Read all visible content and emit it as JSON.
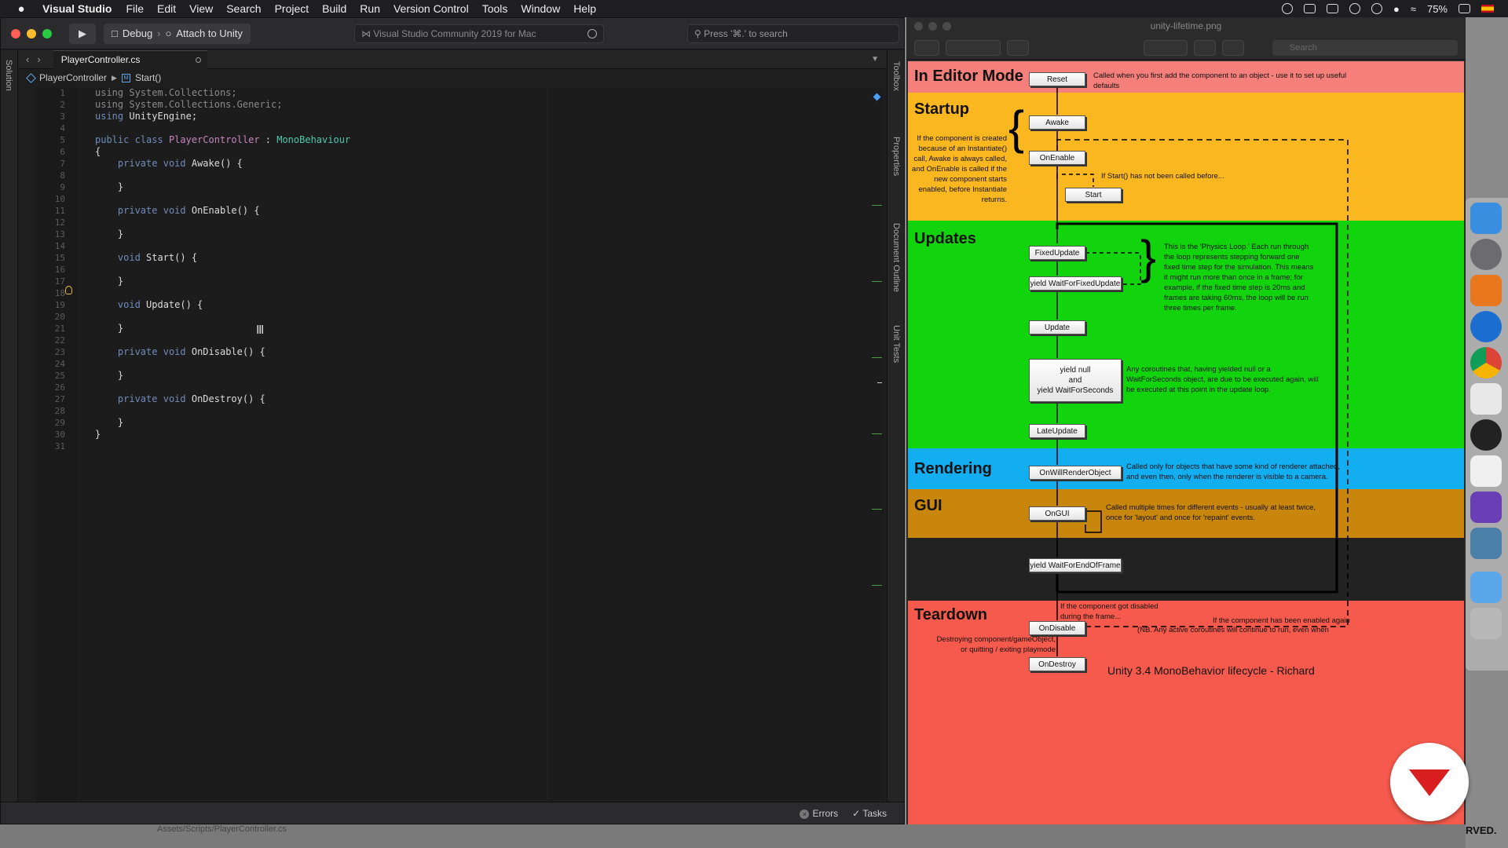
{
  "menubar": {
    "app_name": "Visual Studio",
    "items": [
      "File",
      "Edit",
      "View",
      "Search",
      "Project",
      "Build",
      "Run",
      "Version Control",
      "Tools",
      "Window",
      "Help"
    ],
    "battery": "75%"
  },
  "vs": {
    "config": "Debug",
    "target": "Attach to Unity",
    "status_text": "Visual Studio Community 2019 for Mac",
    "search_placeholder": "Press '⌘.' to search",
    "left_pad": "Solution",
    "right_pads": [
      "Toolbox",
      "Properties",
      "Document Outline",
      "Unit Tests"
    ],
    "tab": "PlayerController.cs",
    "breadcrumb": [
      "PlayerController",
      "Start()"
    ],
    "code_lines": [
      [
        "dim",
        "using System.Collections;"
      ],
      [
        "dim",
        "using System.Collections.Generic;"
      ],
      [
        "",
        "using UnityEngine;"
      ],
      [
        "",
        ""
      ],
      [
        "",
        "public class PlayerController : MonoBehaviour"
      ],
      [
        "",
        "{"
      ],
      [
        "",
        "    private void Awake() {"
      ],
      [
        "",
        ""
      ],
      [
        "",
        "    }"
      ],
      [
        "",
        ""
      ],
      [
        "",
        "    private void OnEnable() {"
      ],
      [
        "",
        ""
      ],
      [
        "",
        "    }"
      ],
      [
        "",
        ""
      ],
      [
        "",
        "    void Start() {"
      ],
      [
        "",
        ""
      ],
      [
        "",
        "    }"
      ],
      [
        "",
        ""
      ],
      [
        "",
        "    void Update() {"
      ],
      [
        "",
        ""
      ],
      [
        "",
        "    }"
      ],
      [
        "",
        ""
      ],
      [
        "",
        "    private void OnDisable() {"
      ],
      [
        "",
        ""
      ],
      [
        "",
        "    }"
      ],
      [
        "",
        ""
      ],
      [
        "",
        "    private void OnDestroy() {"
      ],
      [
        "",
        ""
      ],
      [
        "",
        "    }"
      ],
      [
        "",
        "}"
      ],
      [
        "",
        ""
      ]
    ],
    "status_errors": "Errors",
    "status_tasks": "Tasks",
    "solution_path": "Assets/Scripts/PlayerController.cs"
  },
  "preview": {
    "title": "unity-lifetime.png",
    "search_placeholder": "Search"
  },
  "diagram": {
    "sections": {
      "editor": "In Editor Mode",
      "startup": "Startup",
      "updates": "Updates",
      "rendering": "Rendering",
      "gui": "GUI",
      "teardown": "Teardown"
    },
    "colors": {
      "editor": "#f57f7a",
      "startup": "#fbb71f",
      "updates": "#12d40c",
      "rendering": "#12aef0",
      "gui": "#c8860d",
      "frame_end": "#222222",
      "teardown": "#f55a4c"
    },
    "nodes": {
      "reset": "Reset",
      "awake": "Awake",
      "onenable": "OnEnable",
      "start": "Start",
      "fixedupdate": "FixedUpdate",
      "waitfixed": "yield WaitForFixedUpdate",
      "update": "Update",
      "yieldnull_1": "yield null",
      "yieldnull_2": "and",
      "yieldnull_3": "yield WaitForSeconds",
      "lateupdate": "LateUpdate",
      "onwillrender": "OnWillRenderObject",
      "ongui": "OnGUI",
      "waitendframe": "yield WaitForEndOfFrame",
      "ondisable": "OnDisable",
      "ondestroy": "OnDestroy"
    },
    "notes": {
      "reset": "Called when you first add the component to an object - use it to set up useful defaults",
      "startup": "If the component is created because of an Instantiate() call, Awake is always called, and OnEnable is called if the new component starts enabled, before Instantiate returns.",
      "start": "If Start() has not been called before...",
      "physics": "This is the 'Physics Loop.' Each run through the loop represents stepping forward one fixed time step for the simulation. This means it might run more than once in a frame; for example, if the fixed time step is 20ms and frames are taking 60ms, the loop will be run three times per frame.",
      "coroutines": "Any coroutines that, having yielded null or a WaitForSeconds object, are due to be executed again, will be executed at this point in the update loop.",
      "rendering": "Called only for objects that have some kind of renderer attached, and even then, only when the renderer is visible to a camera.",
      "gui": "Called multiple times for different events - usually at least twice, once for 'layout' and once for 'repaint' events.",
      "disabled": "If the component got disabled during the frame...",
      "reenabled": "If the component has been enabled again",
      "nb": "(NB. Any active coroutines will continue to run, even when",
      "destroying": "Destroying component/gameObject, or quitting / exiting playmode",
      "credit": "Unity 3.4 MonoBehavior lifecycle - Richard"
    }
  },
  "corner_text": "RVED."
}
